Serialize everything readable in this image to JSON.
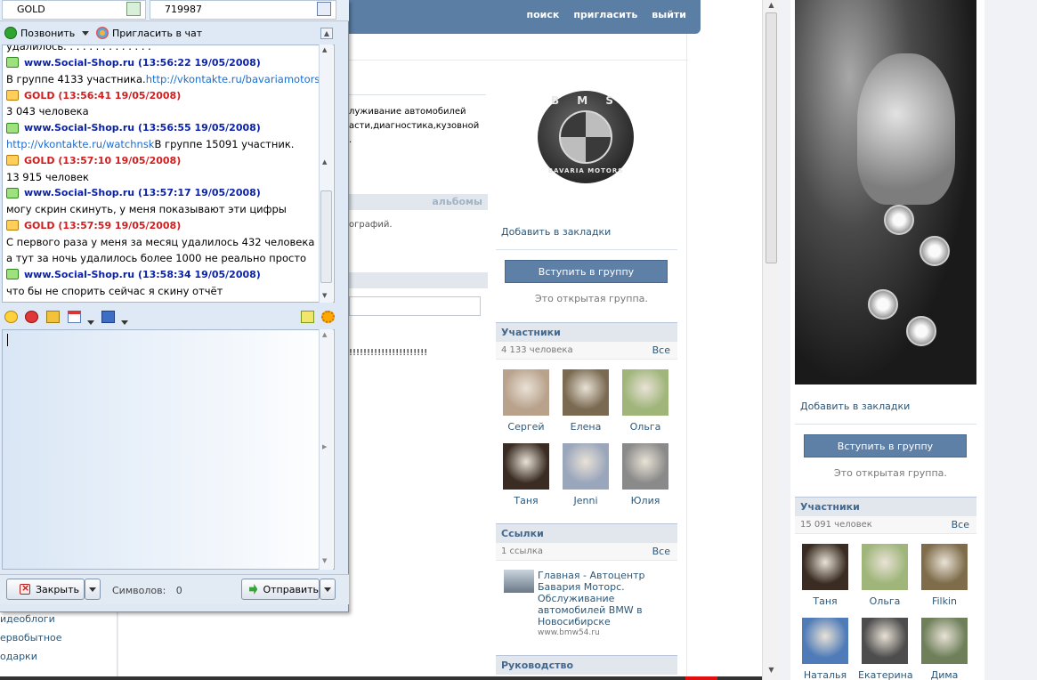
{
  "vk_header": {
    "links": [
      "поиск",
      "пригласить",
      "выйти"
    ]
  },
  "left_sidebar": {
    "items": [
      "идеоблоги",
      "ервобытное",
      "одарки"
    ]
  },
  "main": {
    "description_lines": [
      "луживание автомобилей",
      "асти,диагностика,кузовной",
      "."
    ],
    "albums_label": "альбомы",
    "photos_text": "ографий.",
    "wall_text": "!!!!!!!!!!!!!!!!!!!!!!"
  },
  "group1": {
    "logo_top": "B M S",
    "logo_bottom": "BAVARIA MOTORS",
    "bookmark": "Добавить в закладки",
    "join_button": "Вступить в группу",
    "open_group": "Это открытая группа.",
    "members_title": "Участники",
    "members_count": "4 133 человека",
    "members_all": "Все",
    "members": [
      {
        "name": "Сергей",
        "color": "#b9a28c"
      },
      {
        "name": "Елена",
        "color": "#7a6a52"
      },
      {
        "name": "Ольга",
        "color": "#9fb57a"
      },
      {
        "name": "Таня",
        "color": "#3a2c22"
      },
      {
        "name": "Jenni",
        "color": "#9aa6bc"
      },
      {
        "name": "Юлия",
        "color": "#8a8a8a"
      }
    ],
    "links_title": "Ссылки",
    "links_count": "1 ссылка",
    "links_all": "Все",
    "link_text": "Главная - Автоцентр Бавария Моторс. Обслуживание автомобилей BMW в Новосибирске",
    "link_url": "www.bmw54.ru",
    "leadership_title": "Руководство"
  },
  "group2": {
    "bookmark": "Добавить в закладки",
    "join_button": "Вступить в группу",
    "open_group": "Это открытая группа.",
    "members_title": "Участники",
    "members_count": "15 091 человек",
    "members_all": "Все",
    "members": [
      {
        "name": "Таня",
        "color": "#3a2c22"
      },
      {
        "name": "Ольга",
        "color": "#9fb57a"
      },
      {
        "name": "Filkin",
        "color": "#7e6c4a"
      },
      {
        "name": "Наталья",
        "color": "#4f7bb8"
      },
      {
        "name": "Екатерина",
        "color": "#4d4d4d"
      },
      {
        "name": "Дима",
        "color": "#6e7f5a"
      }
    ]
  },
  "chat": {
    "contact_name": "GOLD",
    "contact_uin": "719987",
    "call_label": "Позвонить",
    "invite_label": "Пригласить в чат",
    "log": [
      {
        "type": "text",
        "text": "удалилось. . . . . . . . . . . . . ."
      },
      {
        "type": "head",
        "who": "blue",
        "text": "www.Social-Shop.ru (13:56:22 19/05/2008)"
      },
      {
        "type": "text",
        "text": "В группе 4133 участника. ",
        "link": "http://vkontakte.ru/bavariamotors"
      },
      {
        "type": "head",
        "who": "red",
        "text": "GOLD (13:56:41 19/05/2008)"
      },
      {
        "type": "text",
        "text": "3 043 человека"
      },
      {
        "type": "head",
        "who": "blue",
        "text": "www.Social-Shop.ru (13:56:55 19/05/2008)"
      },
      {
        "type": "text",
        "link_first": "http://vkontakte.ru/watchnsk",
        "text": " В группе 15091 участник."
      },
      {
        "type": "head",
        "who": "red",
        "text": "GOLD (13:57:10 19/05/2008)"
      },
      {
        "type": "text",
        "text": "13 915 человек"
      },
      {
        "type": "head",
        "who": "blue",
        "text": "www.Social-Shop.ru (13:57:17 19/05/2008)"
      },
      {
        "type": "text",
        "text": "могу скрин скинуть, у меня показывают эти цифры"
      },
      {
        "type": "head",
        "who": "red",
        "text": "GOLD (13:57:59 19/05/2008)"
      },
      {
        "type": "text",
        "text": "С первого раза у меня за месяц удалилось 432 человека ,"
      },
      {
        "type": "text",
        "text": "а тут за ночь удалилось более 1000 не реально просто"
      },
      {
        "type": "head",
        "who": "blue",
        "text": "www.Social-Shop.ru (13:58:34 19/05/2008)"
      },
      {
        "type": "text",
        "text": "что бы не спорить сейчас я скину отчёт"
      }
    ],
    "close_label": "Закрыть",
    "symbols_label": "Символов:",
    "symbols_count": "0",
    "send_label": "Отправить"
  }
}
